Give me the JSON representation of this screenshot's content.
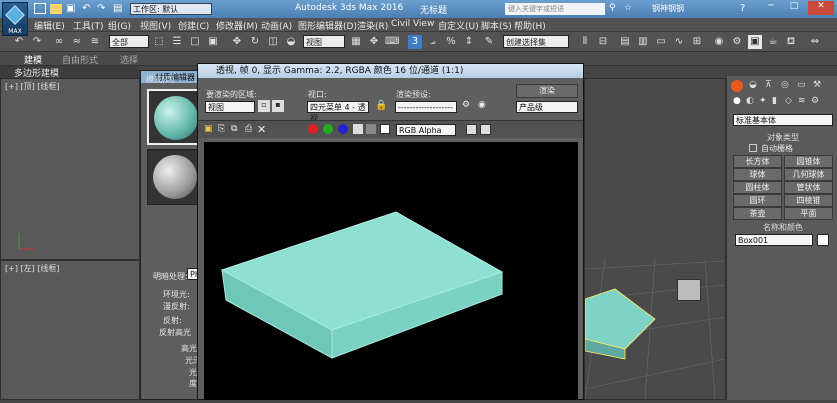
{
  "title_bar": {
    "quick_access": "工作区: 默认",
    "app_title": "Autodesk 3ds Max 2016",
    "doc_title": "无标题",
    "search_placeholder": "键入关键字或短语",
    "user": "钢神钢钢"
  },
  "logo": {
    "label": "MAX"
  },
  "menu": [
    "编辑(E)",
    "工具(T)",
    "组(G)",
    "视图(V)",
    "创建(C)",
    "修改器(M)",
    "动画(A)",
    "图形编辑器(D)",
    "渲染(R)",
    "Civil View",
    "自定义(U)",
    "脚本(S)",
    "帮助(H)"
  ],
  "toolbar": {
    "filter": "全部",
    "viewport_combo": "视图",
    "named_selection": "创建选择集"
  },
  "ribbon": {
    "tabs": [
      "建模",
      "自由形式",
      "选择"
    ],
    "sub": "多边形建模"
  },
  "viewports": {
    "top": "[+] [顶] [线框]",
    "left": "[+] [左] [线框]"
  },
  "material_editor": {
    "title": "材质编辑器 - 01 - Default",
    "menu": [
      "模式(D)",
      "材质"
    ],
    "params": [
      "明暗处理:",
      "环境光:",
      "漫反射:",
      "反射:",
      "反射高光",
      "高光",
      "光泽",
      "光泽度"
    ],
    "shader": "Pho"
  },
  "render_window": {
    "title": "透视, 帧 0, 显示 Gamma: 2.2, RGBA 颜色 16 位/通道 (1:1)",
    "area_label": "要渲染的区域:",
    "area_value": "视图",
    "viewport_label": "视口:",
    "viewport_value": "四元菜单 4 - 透视",
    "preset_label": "渲染预设:",
    "preset_value": "-------------------",
    "render_button": "渲染",
    "product_value": "产品级",
    "channel": "RGB Alpha"
  },
  "command_panel": {
    "dropdown": "标准基本体",
    "object_type_header": "对象类型",
    "auto_grid": "自动栅格",
    "objects": [
      "长方体",
      "圆锥体",
      "球体",
      "几何球体",
      "圆柱体",
      "管状体",
      "圆环",
      "四棱锥",
      "茶壶",
      "平面"
    ],
    "name_color_header": "名称和颜色",
    "object_name": "Box001"
  }
}
